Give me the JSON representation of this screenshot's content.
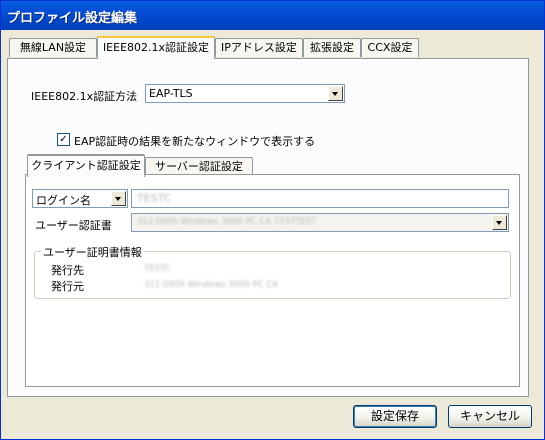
{
  "window": {
    "title": "プロファイル設定編集"
  },
  "tabs": [
    {
      "label": "無線LAN設定",
      "active": false
    },
    {
      "label": "IEEE802.1x認証設定",
      "active": true
    },
    {
      "label": "IPアドレス設定",
      "active": false
    },
    {
      "label": "拡張設定",
      "active": false
    },
    {
      "label": "CCX設定",
      "active": false
    }
  ],
  "auth_method": {
    "label": "IEEE802.1x認証方法",
    "value": "EAP-TLS"
  },
  "show_result_checkbox": {
    "label": "EAP認証時の結果を新たなウィンドウで表示する",
    "checked": true,
    "mark": "✓"
  },
  "sub_tabs": [
    {
      "label": "クライアント認証設定",
      "active": true
    },
    {
      "label": "サーバー認証設定",
      "active": false
    }
  ],
  "client": {
    "login_type": "ログイン名",
    "login_value": "TESTC",
    "cert_label": "ユーザー認証書",
    "cert_value": "312 DATA Windows 3000 PC CA 7737TEST",
    "cert_info": {
      "title": "ユーザー証明書情報",
      "issued_to_label": "発行先",
      "issued_to_value": "TESTC",
      "issued_by_label": "発行元",
      "issued_by_value": "312 DATA Windows 3000 PC CA"
    }
  },
  "buttons": {
    "save": "設定保存",
    "cancel": "キャンセル"
  }
}
